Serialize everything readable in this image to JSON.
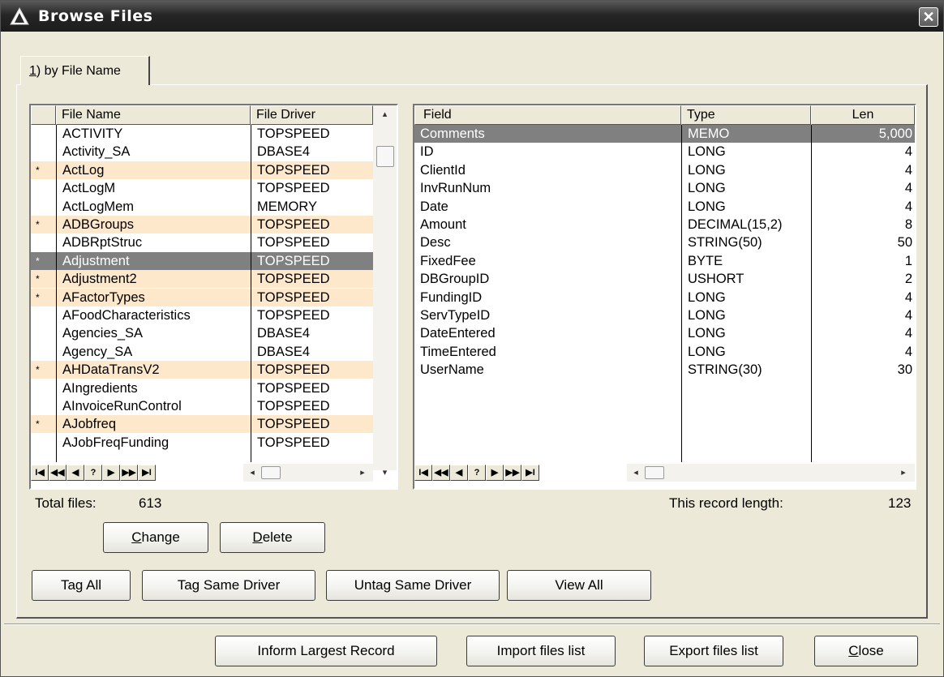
{
  "window": {
    "title": "Browse Files",
    "close_symbol": "✕"
  },
  "tab": {
    "mnemonic": "1",
    "label_rest": ") by File Name"
  },
  "files_list": {
    "columns": [
      "File Name",
      "File Driver"
    ],
    "rows": [
      {
        "tag": "",
        "name": "ACTIVITY",
        "driver": "TOPSPEED",
        "tagged": false,
        "selected": false
      },
      {
        "tag": "",
        "name": "Activity_SA",
        "driver": "DBASE4",
        "tagged": false,
        "selected": false
      },
      {
        "tag": "*",
        "name": "ActLog",
        "driver": "TOPSPEED",
        "tagged": true,
        "selected": false
      },
      {
        "tag": "",
        "name": "ActLogM",
        "driver": "TOPSPEED",
        "tagged": false,
        "selected": false
      },
      {
        "tag": "",
        "name": "ActLogMem",
        "driver": "MEMORY",
        "tagged": false,
        "selected": false
      },
      {
        "tag": "*",
        "name": "ADBGroups",
        "driver": "TOPSPEED",
        "tagged": true,
        "selected": false
      },
      {
        "tag": "",
        "name": "ADBRptStruc",
        "driver": "TOPSPEED",
        "tagged": false,
        "selected": false
      },
      {
        "tag": "*",
        "name": "Adjustment",
        "driver": "TOPSPEED",
        "tagged": true,
        "selected": true
      },
      {
        "tag": "*",
        "name": "Adjustment2",
        "driver": "TOPSPEED",
        "tagged": true,
        "selected": false
      },
      {
        "tag": "*",
        "name": "AFactorTypes",
        "driver": "TOPSPEED",
        "tagged": true,
        "selected": false
      },
      {
        "tag": "",
        "name": "AFoodCharacteristics",
        "driver": "TOPSPEED",
        "tagged": false,
        "selected": false
      },
      {
        "tag": "",
        "name": "Agencies_SA",
        "driver": "DBASE4",
        "tagged": false,
        "selected": false
      },
      {
        "tag": "",
        "name": "Agency_SA",
        "driver": "DBASE4",
        "tagged": false,
        "selected": false
      },
      {
        "tag": "*",
        "name": "AHDataTransV2",
        "driver": "TOPSPEED",
        "tagged": true,
        "selected": false
      },
      {
        "tag": "",
        "name": "AIngredients",
        "driver": "TOPSPEED",
        "tagged": false,
        "selected": false
      },
      {
        "tag": "",
        "name": "AInvoiceRunControl",
        "driver": "TOPSPEED",
        "tagged": false,
        "selected": false
      },
      {
        "tag": "*",
        "name": "AJobfreq",
        "driver": "TOPSPEED",
        "tagged": true,
        "selected": false
      },
      {
        "tag": "",
        "name": "AJobFreqFunding",
        "driver": "TOPSPEED",
        "tagged": false,
        "selected": false
      }
    ]
  },
  "fields_list": {
    "columns": [
      "Field",
      "Type",
      "Len"
    ],
    "rows": [
      {
        "field": "Comments",
        "type": "MEMO",
        "len": "5,000",
        "selected": true
      },
      {
        "field": "ID",
        "type": "LONG",
        "len": "4",
        "selected": false
      },
      {
        "field": "ClientId",
        "type": "LONG",
        "len": "4",
        "selected": false
      },
      {
        "field": "InvRunNum",
        "type": "LONG",
        "len": "4",
        "selected": false
      },
      {
        "field": "Date",
        "type": "LONG",
        "len": "4",
        "selected": false
      },
      {
        "field": "Amount",
        "type": "DECIMAL(15,2)",
        "len": "8",
        "selected": false
      },
      {
        "field": "Desc",
        "type": "STRING(50)",
        "len": "50",
        "selected": false
      },
      {
        "field": "FixedFee",
        "type": "BYTE",
        "len": "1",
        "selected": false
      },
      {
        "field": "DBGroupID",
        "type": "USHORT",
        "len": "2",
        "selected": false
      },
      {
        "field": "FundingID",
        "type": "LONG",
        "len": "4",
        "selected": false
      },
      {
        "field": "ServTypeID",
        "type": "LONG",
        "len": "4",
        "selected": false
      },
      {
        "field": "DateEntered",
        "type": "LONG",
        "len": "4",
        "selected": false
      },
      {
        "field": "TimeEntered",
        "type": "LONG",
        "len": "4",
        "selected": false
      },
      {
        "field": "UserName",
        "type": "STRING(30)",
        "len": "30",
        "selected": false
      }
    ]
  },
  "nav": {
    "first": "I◀",
    "prev_page": "◀◀",
    "prev": "◀",
    "locate": "?",
    "next": "▶",
    "next_page": "▶▶",
    "last": "▶I"
  },
  "scroll": {
    "left": "◂",
    "right": "▸",
    "up": "▴",
    "down": "▾"
  },
  "status": {
    "total_files_label": "Total files:",
    "total_files_value": "613",
    "record_length_label": "This record length:",
    "record_length_value": "123"
  },
  "buttons": {
    "change_mnemonic": "C",
    "change_rest": "hange",
    "delete_mnemonic": "D",
    "delete_rest": "elete",
    "tag_all": "Tag All",
    "tag_same_driver": "Tag Same Driver",
    "untag_same_driver": "Untag Same Driver",
    "view_all": "View All",
    "inform_largest_record": "Inform Largest Record",
    "import_files_list": "Import files list",
    "export_files_list": "Export files list",
    "close_mnemonic": "C",
    "close_rest": "lose"
  }
}
